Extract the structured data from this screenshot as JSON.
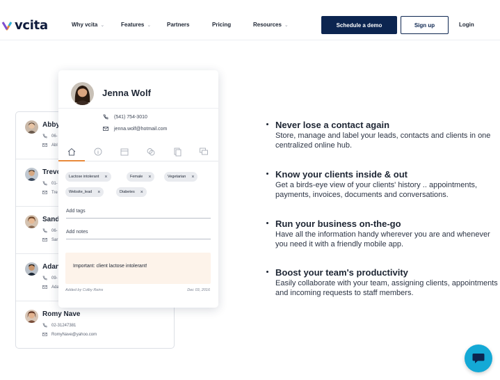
{
  "brand": {
    "name": "vcita"
  },
  "nav": {
    "items": [
      {
        "label": "Why vcita",
        "dropdown": true
      },
      {
        "label": "Features",
        "dropdown": true
      },
      {
        "label": "Partners",
        "dropdown": false
      },
      {
        "label": "Pricing",
        "dropdown": false
      },
      {
        "label": "Resources",
        "dropdown": true
      }
    ],
    "demo_label": "Schedule a demo",
    "signup_label": "Sign up",
    "login_label": "Login"
  },
  "contact_list": [
    {
      "name": "Abby",
      "phone": "06-",
      "email": "Abl"
    },
    {
      "name": "Trevo",
      "phone": "01-",
      "email": "Tre"
    },
    {
      "name": "Sand",
      "phone": "06-",
      "email": "Sar"
    },
    {
      "name": "Adan",
      "phone": "09-",
      "email": "Ada"
    },
    {
      "name": "Romy Nave",
      "phone": "02-31247381",
      "email": "RomyNave@yahoo.com"
    }
  ],
  "profile": {
    "name": "Jenna Wolf",
    "phone": "(541) 754-3010",
    "email": "jenna.wolf@hotmail.com",
    "tabs": [
      "home-icon",
      "info-icon",
      "calendar-icon",
      "coins-icon",
      "documents-icon",
      "chat-icon"
    ],
    "tags": [
      "Lactose intolerant",
      "Female",
      "Vegetarian",
      "Website_lead",
      "Diabetes"
    ],
    "add_tags_label": "Add tags",
    "add_notes_label": "Add notes",
    "note_text": "Important: client lactose intolerant!",
    "note_author": "Added by Colby Reins",
    "note_date": "Dec 03, 2016"
  },
  "features": [
    {
      "title": "Never lose a contact again",
      "desc": "Store, manage and label your leads, contacts and clients in one centralized online hub."
    },
    {
      "title": "Know your clients inside & out",
      "desc": "Get a birds-eye view of your clients' history .. appointments, payments, invoices, documents and conversations."
    },
    {
      "title": "Run your business on-the-go",
      "desc": "Have all the information handy wherever you are and whenever you need it with a friendly mobile app."
    },
    {
      "title": "Boost your team's productivity",
      "desc": "Easily collaborate with your team, assigning clients, appointments and incoming requests to staff members."
    }
  ],
  "colors": {
    "primary": "#0c2550",
    "accent": "#e8893a",
    "chat": "#14a9d6",
    "note_bg": "#fdf3ea"
  }
}
